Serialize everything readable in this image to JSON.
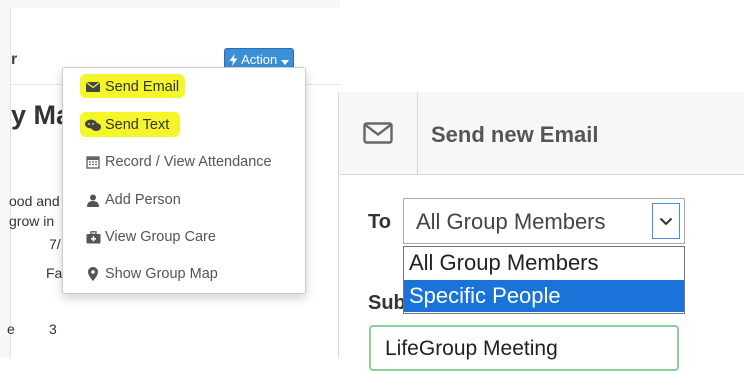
{
  "left": {
    "header_text": "r",
    "action_label": "Action",
    "page_title": "y Ma",
    "fragments": {
      "line1": "ood and",
      "line2": "grow in",
      "val1": "7/",
      "val2": "Fa",
      "val3": "e",
      "val4": "3"
    }
  },
  "dropdown": {
    "items": [
      {
        "label": "Send Email",
        "icon": "envelope-icon",
        "highlighted": true
      },
      {
        "label": "Send Text",
        "icon": "chat-icon",
        "highlighted": true
      },
      {
        "label": "Record / View Attendance",
        "icon": "calendar-icon",
        "highlighted": false
      },
      {
        "label": "Add Person",
        "icon": "user-icon",
        "highlighted": false
      },
      {
        "label": "View Group Care",
        "icon": "medkit-icon",
        "highlighted": false
      },
      {
        "label": "Show Group Map",
        "icon": "map-marker-icon",
        "highlighted": false
      }
    ],
    "highlight_color": "#f4f62a"
  },
  "modal": {
    "title": "Send new Email",
    "to_label": "To",
    "selected_value": "All Group Members",
    "options": [
      {
        "label": "All Group Members",
        "selected": false
      },
      {
        "label": "Specific People",
        "selected": true
      }
    ],
    "subject_label": "Subj",
    "subject_value": "LifeGroup Meeting"
  },
  "colors": {
    "action_button": "#3a8fd6",
    "option_selected": "#1a73d9",
    "subject_border": "#8cd19a"
  }
}
